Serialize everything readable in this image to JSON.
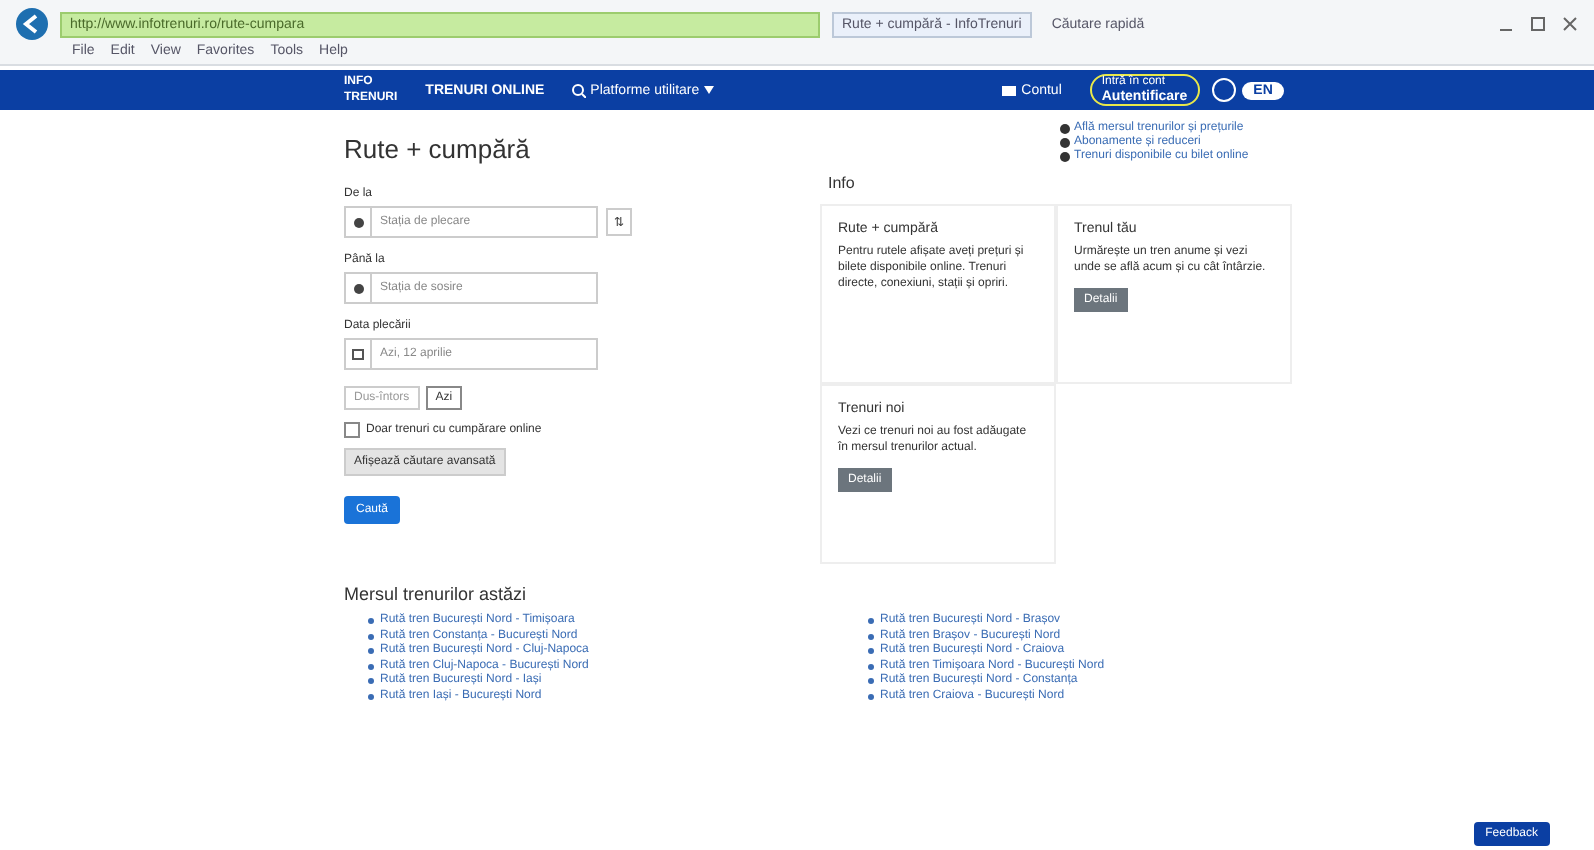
{
  "browser": {
    "address": "http://www.infotrenuri.ro/rute-cumpara",
    "tab": "Rute + cumpără - InfoTrenuri",
    "tab2": "Căutare rapidă",
    "menu": [
      "File",
      "Edit",
      "View",
      "Favorites",
      "Tools",
      "Help"
    ]
  },
  "nav": {
    "logo_top": "INFO",
    "logo_bottom": "TRENURI",
    "brand": "TRENURI ONLINE",
    "menu": "Platforme utilitare",
    "account": "Contul",
    "login_top": "Intră în cont",
    "login": "Autentificare",
    "lang": "EN"
  },
  "quick_links": [
    "Află mersul trenurilor și prețurile",
    "Abonamente și reduceri",
    "Trenuri disponibile cu bilet online"
  ],
  "form": {
    "title": "Rute + cumpără",
    "fields": [
      {
        "label": "De la",
        "placeholder": "Stația de plecare",
        "swap": "⇅"
      },
      {
        "label": "Până la",
        "placeholder": "Stația de sosire"
      },
      {
        "label": "Data plecării",
        "placeholder": "Azi, 12 aprilie"
      }
    ],
    "options": [
      {
        "label": "Dus-întors",
        "selected": false
      },
      {
        "label": "Azi",
        "selected": true
      }
    ],
    "checkbox": {
      "label": "Doar trenuri cu cumpărare online",
      "checked": false
    },
    "advanced": "Afișează căutare avansată",
    "submit": "Caută"
  },
  "info": {
    "title": "Info",
    "cards": [
      {
        "title": "Rute + cumpără",
        "text": "Pentru rutele afișate aveți prețuri și bilete disponibile online. Trenuri directe, conexiuni, stații și opriri."
      },
      {
        "title": "Trenul tău",
        "text": "Urmărește un tren anume și vezi unde se află acum și cu cât întârzie.",
        "button": "Detalii"
      },
      {
        "title": "Trenuri noi",
        "text": "Vezi ce trenuri noi au fost adăugate în mersul trenurilor actual.",
        "button": "Detalii"
      }
    ]
  },
  "routes": {
    "title": "Mersul trenurilor astăzi",
    "left": [
      "Rută tren București Nord - Timișoara",
      "Rută tren Constanța - București Nord",
      "Rută tren București Nord - Cluj-Napoca",
      "Rută tren Cluj-Napoca - București Nord",
      "Rută tren București Nord - Iași",
      "Rută tren Iași - București Nord"
    ],
    "right": [
      "Rută tren București Nord - Brașov",
      "Rută tren Brașov - București Nord",
      "Rută tren București Nord - Craiova",
      "Rută tren Timișoara Nord - București Nord",
      "Rută tren București Nord - Constanța",
      "Rută tren Craiova - București Nord"
    ]
  },
  "feedback": "Feedback"
}
